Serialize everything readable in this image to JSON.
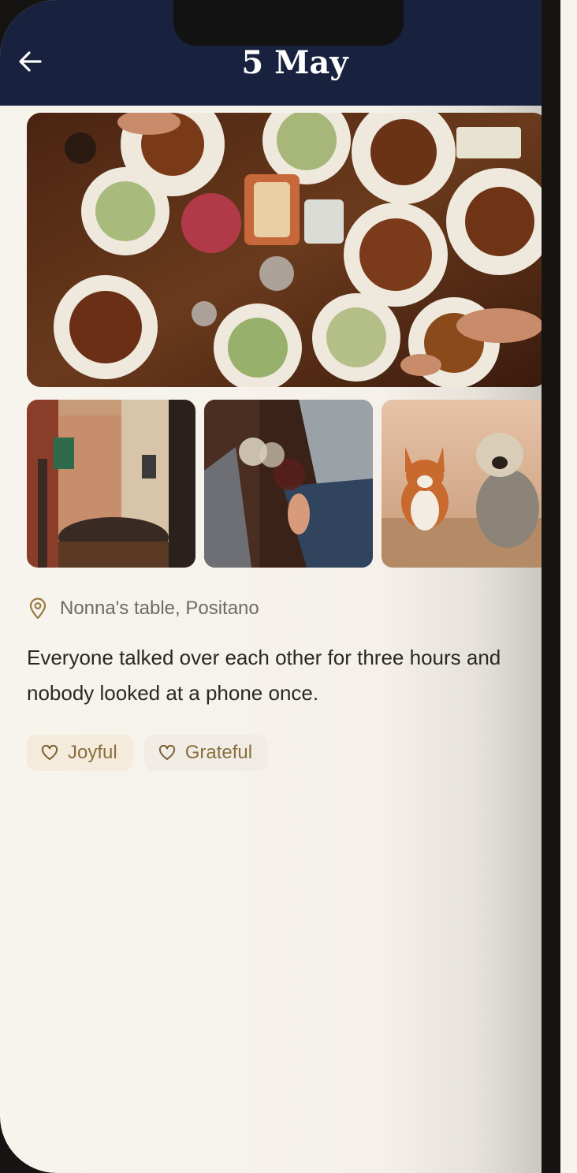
{
  "header": {
    "title": "5 May",
    "back_icon": "arrow-left-icon"
  },
  "photos": {
    "hero": {
      "subject": "overhead dinner table with plates of food"
    },
    "thumbnails": [
      {
        "subject": "outdoor cafe in narrow street"
      },
      {
        "subject": "friends toasting with wine glasses"
      },
      {
        "subject": "two dogs running outdoors"
      }
    ]
  },
  "location": {
    "icon": "map-pin-icon",
    "text": "Nonna's table, Positano"
  },
  "note": {
    "text": "Everyone talked over each other for three hours and nobody looked at a phone once."
  },
  "tags": [
    {
      "label": "Joyful",
      "icon": "heart-icon"
    },
    {
      "label": "Grateful",
      "icon": "heart-icon"
    }
  ],
  "colors": {
    "header_bg": "#18223f",
    "page_bg": "#f7f4ee",
    "accent": "#8a6e3c"
  }
}
